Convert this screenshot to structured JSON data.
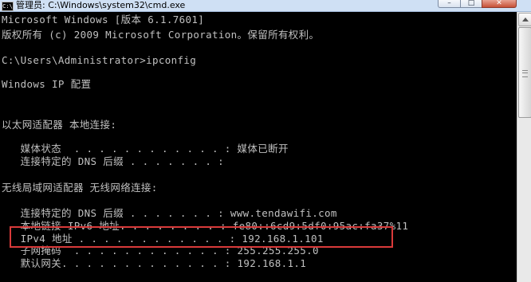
{
  "window": {
    "title": "管理员: C:\\Windows\\system32\\cmd.exe",
    "icon_label": "C:\\",
    "icon": "cmd-icon",
    "buttons": {
      "minimize": "–",
      "maximize": "□",
      "close": "✕"
    }
  },
  "console": {
    "lines": [
      "Microsoft Windows [版本 6.1.7601]",
      "版权所有 (c) 2009 Microsoft Corporation。保留所有权利。",
      "",
      "C:\\Users\\Administrator>ipconfig",
      "",
      "Windows IP 配置",
      "",
      "",
      "以太网适配器 本地连接:",
      "",
      "   媒体状态  . . . . . . . . . . . . : 媒体已断开",
      "   连接特定的 DNS 后缀 . . . . . . . :",
      "",
      "无线局域网适配器 无线网络连接:",
      "",
      "   连接特定的 DNS 后缀 . . . . . . . : www.tendawifi.com",
      "   本地链接 IPv6 地址. . . . . . . . : fe80::6cd9:5df0:95ac:fa37%11",
      "   IPv4 地址 . . . . . . . . . . . . : 192.168.1.101",
      "   子网掩码  . . . . . . . . . . . . : 255.255.255.0",
      "   默认网关. . . . . . . . . . . . . : 192.168.1.1"
    ]
  },
  "annotation": {
    "color": "#d93a3a"
  },
  "colors": {
    "console_bg": "#000000",
    "console_text": "#c0c0c0",
    "titlebar": "#cfe0f4"
  }
}
